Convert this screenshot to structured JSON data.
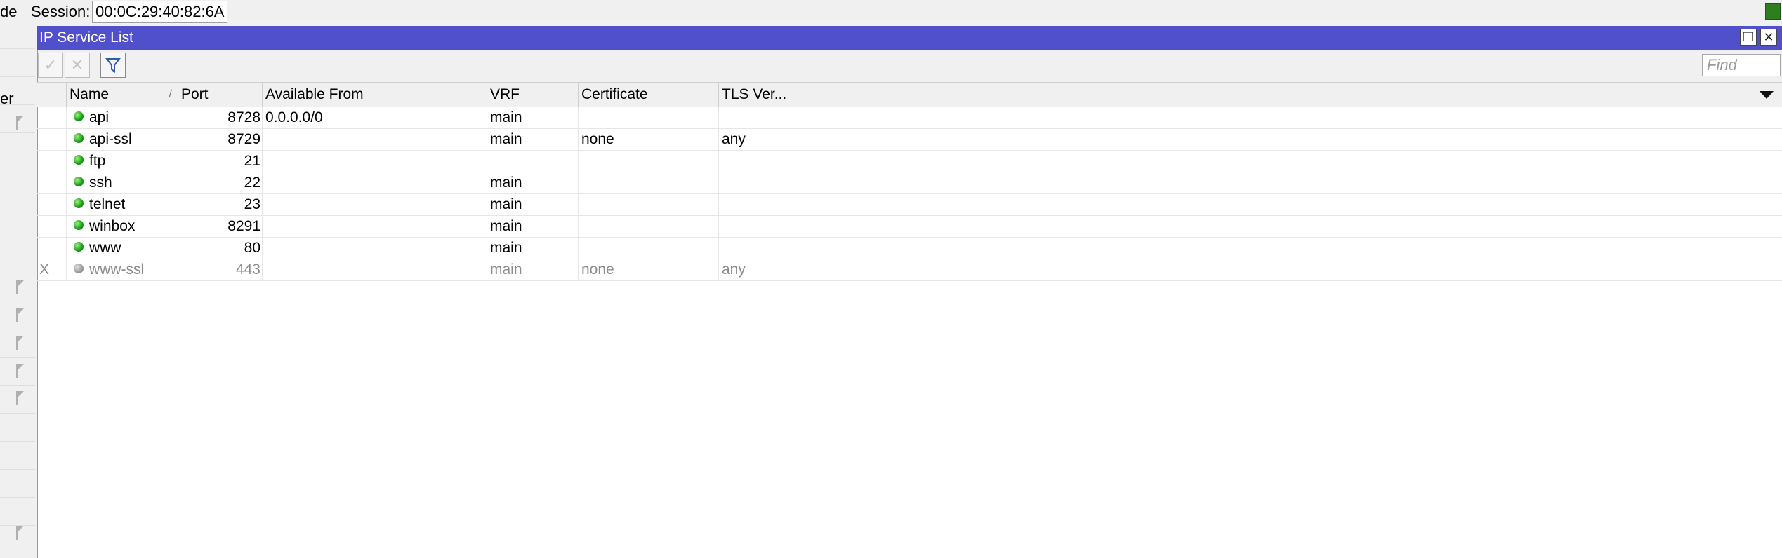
{
  "topbar": {
    "left_cut_text": "de",
    "session_label": "Session:",
    "session_value": "00:0C:29:40:82:6A"
  },
  "sidebar": {
    "cut_text": "er"
  },
  "window": {
    "title": "IP Service List",
    "restore_icon": "restore-icon",
    "close_icon": "close-icon",
    "close_glyph": "✕",
    "restore_glyph": "❐"
  },
  "toolbar": {
    "enable_glyph": "✓",
    "disable_glyph": "✕",
    "find_placeholder": "Find"
  },
  "table": {
    "columns": {
      "name": "Name",
      "sort_mark": "/",
      "port": "Port",
      "available_from": "Available From",
      "vrf": "VRF",
      "certificate": "Certificate",
      "tls": "TLS Ver..."
    },
    "rows": [
      {
        "flag": "",
        "name": "api",
        "port": "8728",
        "available_from": "0.0.0.0/0",
        "vrf": "main",
        "certificate": "",
        "tls": "",
        "enabled": true
      },
      {
        "flag": "",
        "name": "api-ssl",
        "port": "8729",
        "available_from": "",
        "vrf": "main",
        "certificate": "none",
        "tls": "any",
        "enabled": true
      },
      {
        "flag": "",
        "name": "ftp",
        "port": "21",
        "available_from": "",
        "vrf": "",
        "certificate": "",
        "tls": "",
        "enabled": true
      },
      {
        "flag": "",
        "name": "ssh",
        "port": "22",
        "available_from": "",
        "vrf": "main",
        "certificate": "",
        "tls": "",
        "enabled": true
      },
      {
        "flag": "",
        "name": "telnet",
        "port": "23",
        "available_from": "",
        "vrf": "main",
        "certificate": "",
        "tls": "",
        "enabled": true
      },
      {
        "flag": "",
        "name": "winbox",
        "port": "8291",
        "available_from": "",
        "vrf": "main",
        "certificate": "",
        "tls": "",
        "enabled": true
      },
      {
        "flag": "",
        "name": "www",
        "port": "80",
        "available_from": "",
        "vrf": "main",
        "certificate": "",
        "tls": "",
        "enabled": true
      },
      {
        "flag": "X",
        "name": "www-ssl",
        "port": "443",
        "available_from": "",
        "vrf": "main",
        "certificate": "none",
        "tls": "any",
        "enabled": false
      }
    ]
  },
  "colors": {
    "titlebar": "#5050cd",
    "enabled_dot": "#1a9a1a",
    "disabled_dot": "#9a9a9a",
    "session_indicator": "#2e7d1e"
  }
}
